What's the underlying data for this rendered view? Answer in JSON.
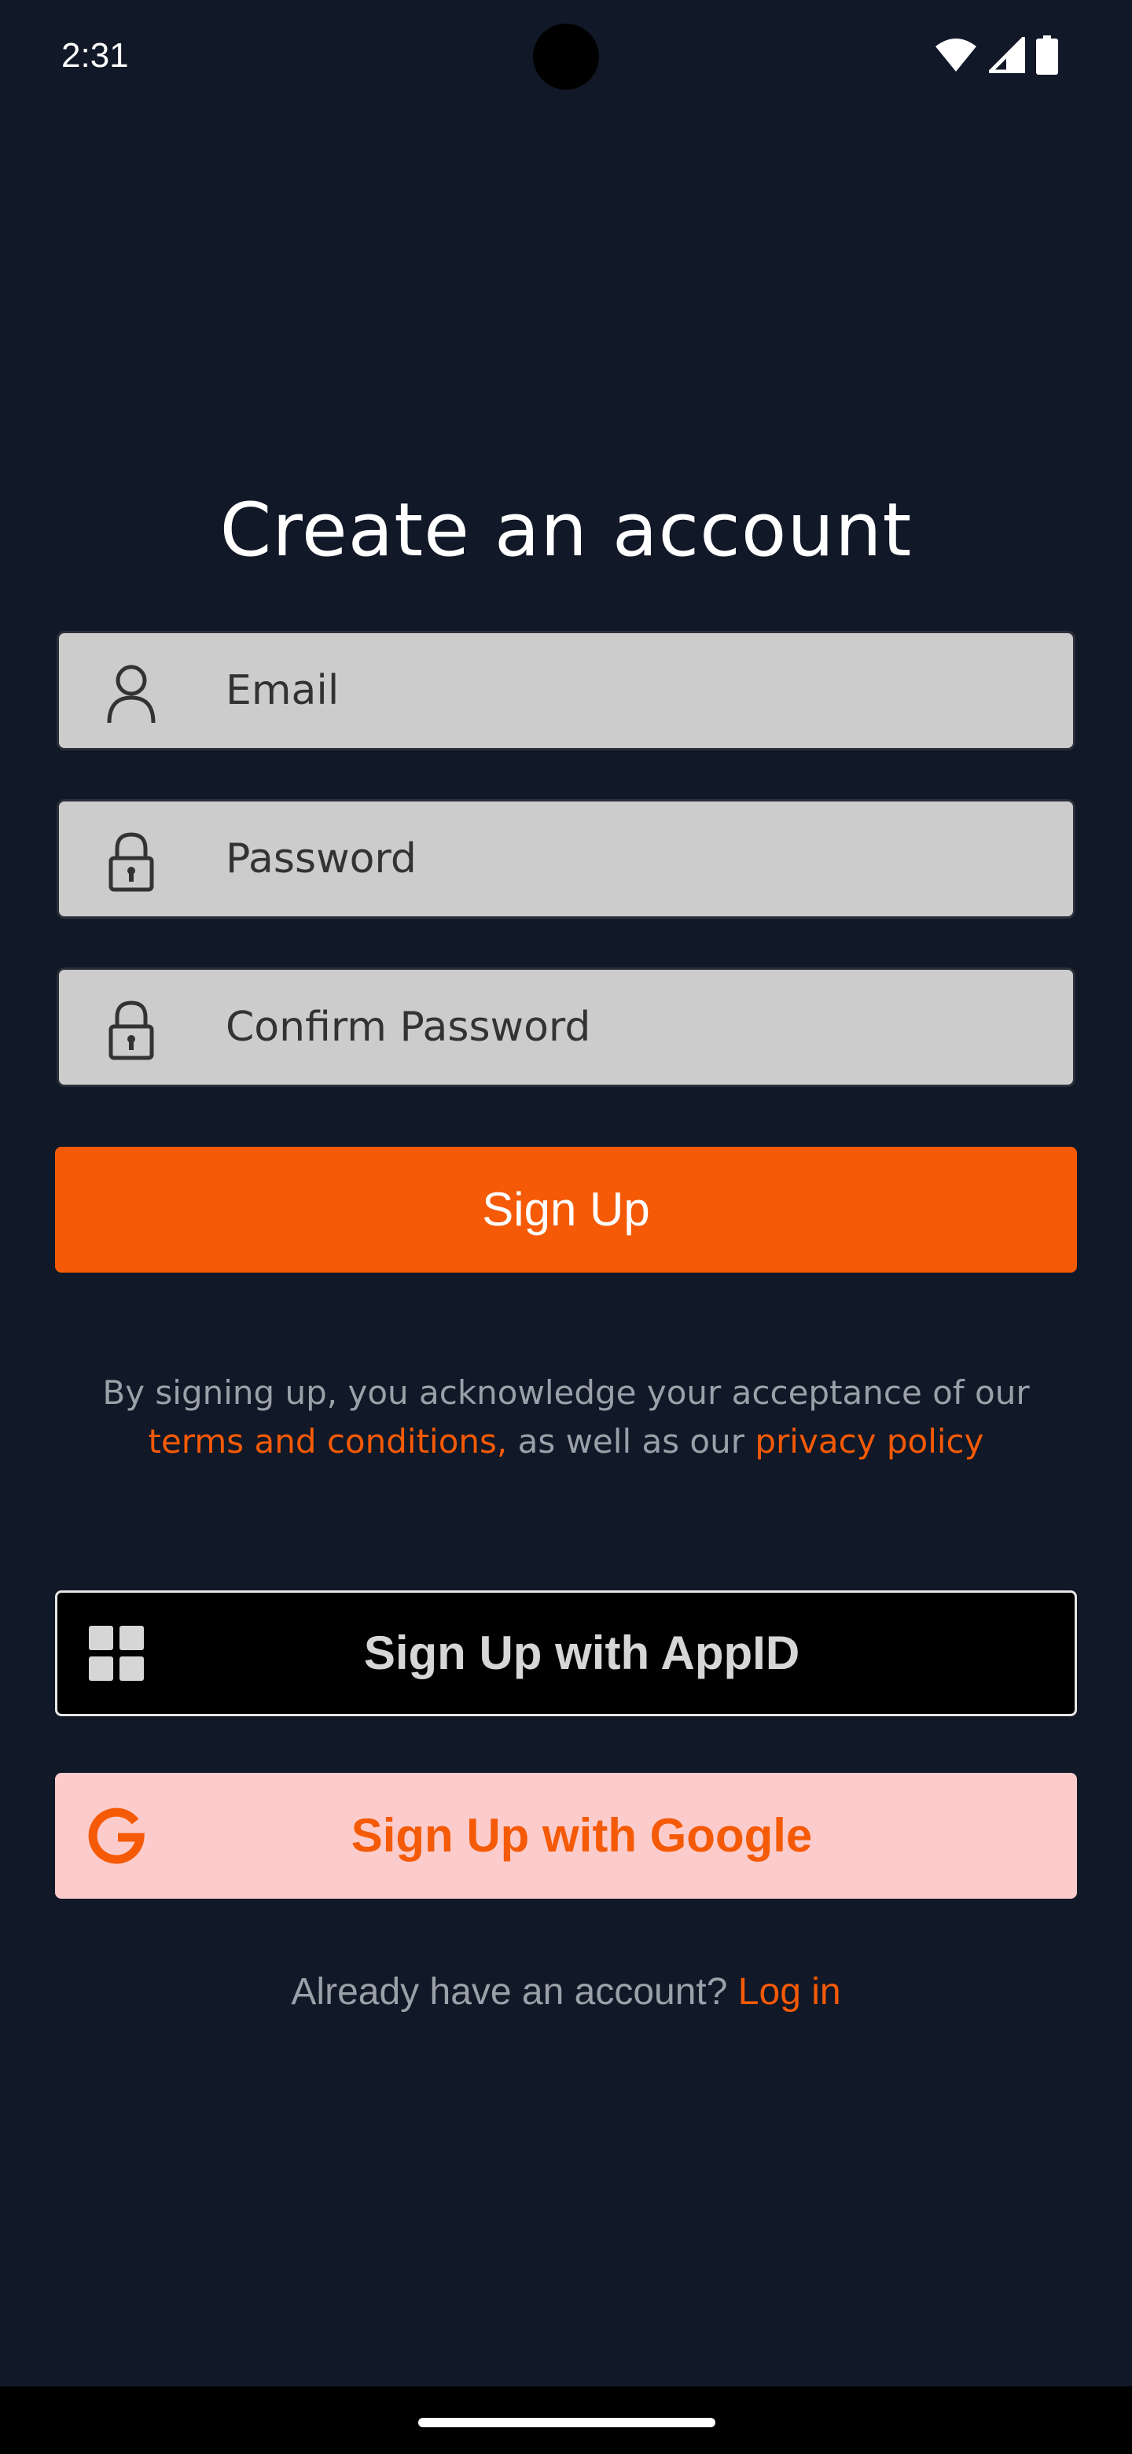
{
  "status_bar": {
    "time": "2:31",
    "icons": [
      "wifi-icon",
      "cellular-signal-icon",
      "battery-icon"
    ]
  },
  "title": "Create an account",
  "form": {
    "email_placeholder": "Email",
    "password_placeholder": "Password",
    "confirm_password_placeholder": "Confirm Password"
  },
  "signup_button": "Sign Up",
  "terms": {
    "prefix": "By signing up, you acknowledge your acceptance of our",
    "terms_link": "terms and conditions,",
    "middle": " as well as our ",
    "privacy_link": "privacy policy"
  },
  "appid_button": "Sign Up with AppID",
  "google_button": "Sign Up with Google",
  "login": {
    "prompt": "Already have an account? ",
    "link": "Log in"
  },
  "colors": {
    "background": "#111827",
    "accent": "#f55a06",
    "field_bg": "#cccccc",
    "google_bg": "#fccccc"
  }
}
